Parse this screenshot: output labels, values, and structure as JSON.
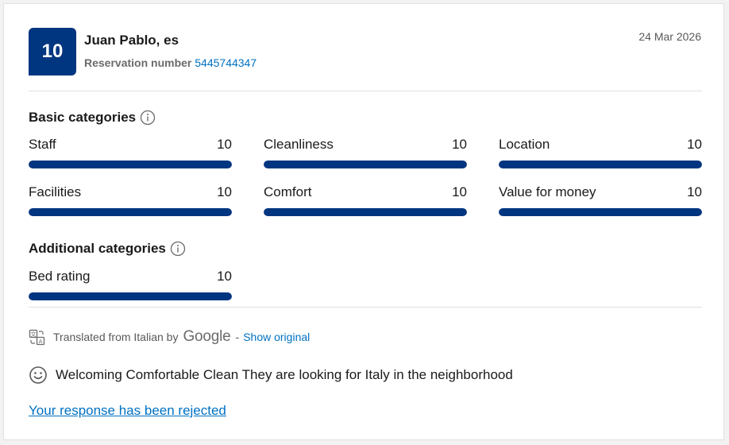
{
  "review": {
    "score": "10",
    "reviewer_name": "Juan Pablo, es",
    "reservation_label": "Reservation number",
    "reservation_number": "5445744347",
    "date": "24 Mar 2026"
  },
  "basic": {
    "title": "Basic categories",
    "items": [
      {
        "label": "Staff",
        "score": "10",
        "fraction": 1.0
      },
      {
        "label": "Cleanliness",
        "score": "10",
        "fraction": 1.0
      },
      {
        "label": "Location",
        "score": "10",
        "fraction": 1.0
      },
      {
        "label": "Facilities",
        "score": "10",
        "fraction": 1.0
      },
      {
        "label": "Comfort",
        "score": "10",
        "fraction": 1.0
      },
      {
        "label": "Value for money",
        "score": "10",
        "fraction": 1.0
      }
    ]
  },
  "additional": {
    "title": "Additional categories",
    "items": [
      {
        "label": "Bed rating",
        "score": "10",
        "fraction": 1.0
      }
    ]
  },
  "translation": {
    "text": "Translated from Italian by",
    "provider": "Google",
    "separator": "-",
    "show_original": "Show original"
  },
  "review_text": "Welcoming Comfortable Clean They are looking for Italy in the neighborhood",
  "response_link": "Your response has been rejected",
  "colors": {
    "brand": "#003580",
    "link": "#0071c2"
  },
  "icons": {
    "info": "info-icon",
    "translate": "translate-icon",
    "smile": "smile-icon"
  }
}
